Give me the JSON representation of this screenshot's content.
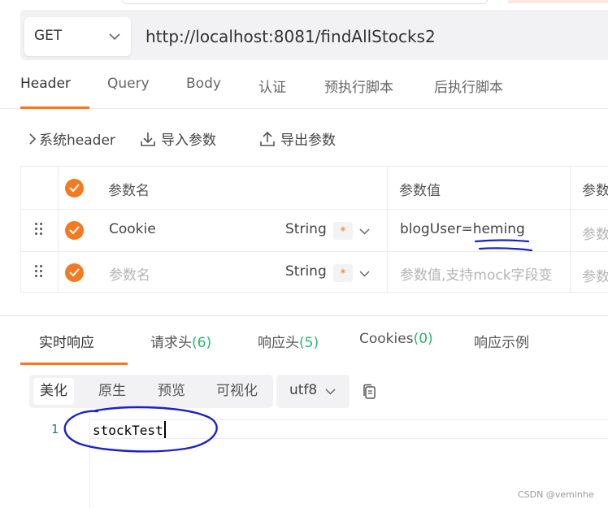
{
  "request": {
    "method": "GET",
    "url": "http://localhost:8081/findAllStocks2"
  },
  "request_tabs": [
    {
      "label": "Header",
      "active": true
    },
    {
      "label": "Query"
    },
    {
      "label": "Body"
    },
    {
      "label": "认证"
    },
    {
      "label": "预执行脚本"
    },
    {
      "label": "后执行脚本"
    }
  ],
  "header_toolbar": {
    "system_header": "系统header",
    "import_params": "导入参数",
    "export_params": "导出参数"
  },
  "params_table": {
    "col_name": "参数名",
    "col_value": "参数值",
    "col_extra": "参数",
    "rows": [
      {
        "name": "Cookie",
        "type": "String",
        "required_mark": "*",
        "value": "blogUser=heming",
        "extra": "参数"
      },
      {
        "name": "参数名",
        "type": "String",
        "required_mark": "*",
        "value": "参数值,支持mock字段变",
        "extra": "参数",
        "placeholder": true
      }
    ]
  },
  "response_tabs": {
    "realtime": "实时响应",
    "request_headers": "请求头",
    "request_headers_count": "(6)",
    "response_headers": "响应头",
    "response_headers_count": "(5)",
    "cookies": "Cookies",
    "cookies_count": "(0)",
    "example": "响应示例"
  },
  "format_buttons": [
    "美化",
    "原生",
    "预览",
    "可视化"
  ],
  "encoding": "utf8",
  "editor": {
    "line_number": "1",
    "code": "stockTest"
  },
  "watermark": "CSDN @veminhe",
  "colors": {
    "accent": "#f37a20",
    "count_green": "#2ab673",
    "annotation_blue": "#1a22c8"
  }
}
